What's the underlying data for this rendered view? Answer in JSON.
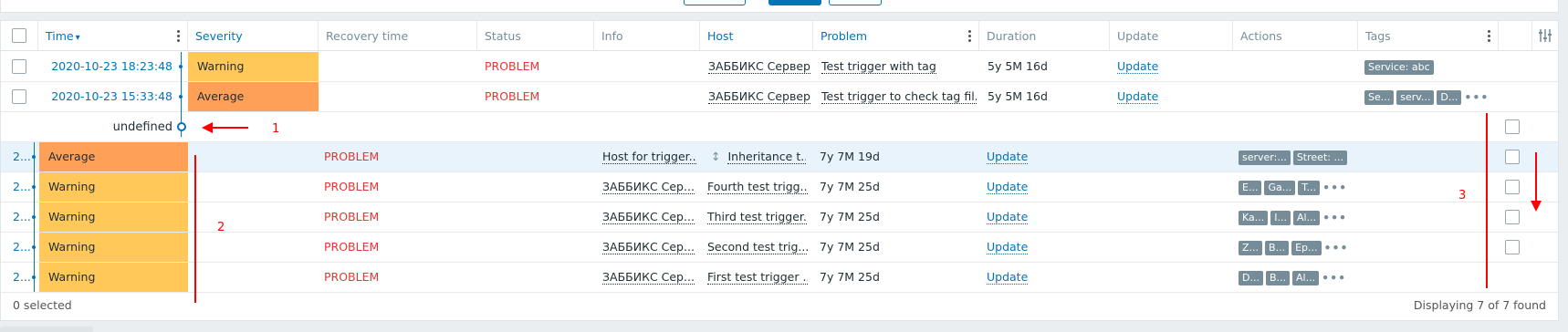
{
  "filter_buttons": [
    {
      "kind": "secondary"
    },
    {
      "kind": "primary"
    },
    {
      "kind": "secondary"
    }
  ],
  "columns": [
    {
      "label": "",
      "name": "select-all"
    },
    {
      "label": "Time",
      "sort": "▾"
    },
    {
      "label": "Severity"
    },
    {
      "label": "Recovery time"
    },
    {
      "label": "Status"
    },
    {
      "label": "Info"
    },
    {
      "label": "Host"
    },
    {
      "label": "Problem"
    },
    {
      "label": "Duration"
    },
    {
      "label": "Update"
    },
    {
      "label": "Actions"
    },
    {
      "label": "Tags"
    }
  ],
  "events": [
    {
      "time": "2020-10-23 18:23:48",
      "severity": "Warning",
      "status": "PROBLEM",
      "host": "ЗАББИКС Сервер",
      "problem": "Test trigger with tag",
      "duration": "5y 5M 16d",
      "update": "Update",
      "tags": [
        "Service: abc"
      ],
      "more": ""
    },
    {
      "time": "2020-10-23 15:33:48",
      "severity": "Average",
      "status": "PROBLEM",
      "host": "ЗАББИКС Сервер",
      "problem": "Test trigger to check tag fil...",
      "duration": "5y 5M 16d",
      "update": "Update",
      "tags": [
        "Se...",
        "serv...",
        "D..."
      ],
      "more": "•••"
    }
  ],
  "marker": {
    "label": "undefined"
  },
  "shifted_rows": [
    {
      "time": "2...",
      "severity": "Average",
      "status": "PROBLEM",
      "info": "Host for trigger...",
      "host_icon": "↕",
      "host": "Inheritance t...",
      "duration": "7y 7M 19d",
      "update": "Update",
      "tags": [
        "server:...",
        "Street: ..."
      ],
      "more": ""
    },
    {
      "time": "2...",
      "severity": "Warning",
      "status": "PROBLEM",
      "info": "ЗАББИКС Сер...",
      "host_icon": "",
      "host": "Fourth test trigg...",
      "duration": "7y 7M 25d",
      "update": "Update",
      "tags": [
        "E...",
        "Ga...",
        "T..."
      ],
      "more": "•••"
    },
    {
      "time": "2...",
      "severity": "Warning",
      "status": "PROBLEM",
      "info": "ЗАББИКС Сер...",
      "host_icon": "",
      "host": "Third test trigger...",
      "duration": "7y 7M 25d",
      "update": "Update",
      "tags": [
        "Ka...",
        "I...",
        "Al..."
      ],
      "more": "•••"
    },
    {
      "time": "2...",
      "severity": "Warning",
      "status": "PROBLEM",
      "info": "ЗАББИКС Сер...",
      "host_icon": "",
      "host": "Second test trig...",
      "duration": "7y 7M 25d",
      "update": "Update",
      "tags": [
        "Z...",
        "B...",
        "Ep..."
      ],
      "more": "•••"
    },
    {
      "time": "2...",
      "severity": "Warning",
      "status": "PROBLEM",
      "info": "ЗАББИКС Сер...",
      "host_icon": "",
      "host": "First test trigger ...",
      "duration": "7y 7M 25d",
      "update": "Update",
      "tags": [
        "D...",
        "B...",
        "Al..."
      ],
      "more": "•••"
    }
  ],
  "annotations": [
    "1",
    "2",
    "3"
  ],
  "footer": {
    "selected": "0 selected",
    "count": "Displaying 7 of 7 found"
  },
  "colors": {
    "warning": "#ffc859",
    "average": "#ffa059",
    "problem": "#e33734",
    "link": "#0275b8",
    "annotation": "#ff0000"
  }
}
